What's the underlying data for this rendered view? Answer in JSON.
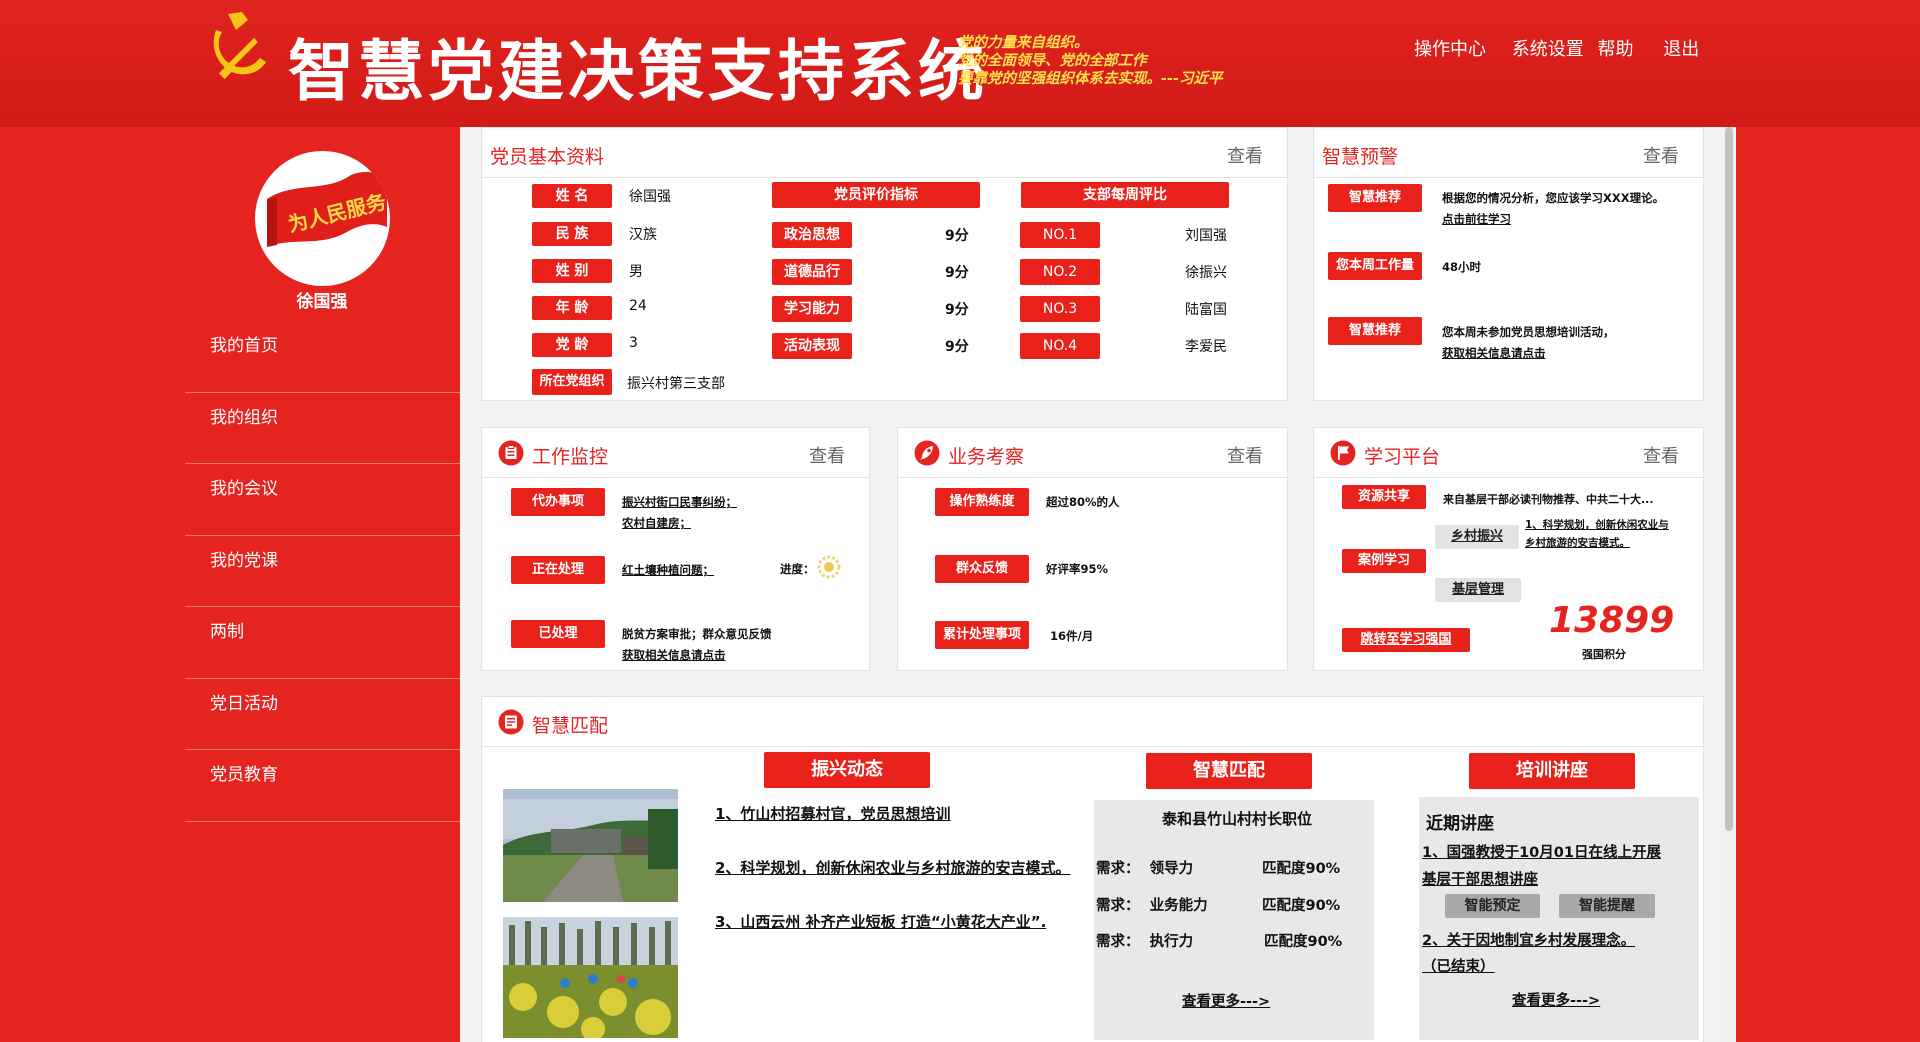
{
  "header": {
    "title": "智慧党建决策支持系统",
    "quote_lines": [
      "党的力量来自组织。",
      "党的全面领导、党的全部工作",
      "要靠党的坚强组织体系去实现。---习近平"
    ],
    "nav": [
      "操作中心",
      "系统设置",
      "帮助",
      "退出"
    ]
  },
  "sidebar": {
    "avatar_text": "为人民服务",
    "username": "徐国强",
    "menu": [
      "我的首页",
      "我的组织",
      "我的会议",
      "我的党课",
      "两制",
      "党日活动",
      "党员教育"
    ]
  },
  "profile": {
    "title": "党员基本资料",
    "more": "查看",
    "fields": [
      {
        "label": "姓 名",
        "value": "徐国强"
      },
      {
        "label": "民 族",
        "value": "汉族"
      },
      {
        "label": "姓 别",
        "value": "男"
      },
      {
        "label": "年 龄",
        "value": "24"
      },
      {
        "label": "党 龄",
        "value": "3"
      },
      {
        "label": "所在党组织",
        "value": "振兴村第三支部"
      }
    ],
    "eval_header": "党员评价指标",
    "evals": [
      {
        "label": "政治思想",
        "score": "9分"
      },
      {
        "label": "道德品行",
        "score": "9分"
      },
      {
        "label": "学习能力",
        "score": "9分"
      },
      {
        "label": "活动表现",
        "score": "9分"
      }
    ],
    "rank_header": "支部每周评比",
    "ranks": [
      {
        "label": "NO.1",
        "name": "刘国强"
      },
      {
        "label": "NO.2",
        "name": "徐振兴"
      },
      {
        "label": "NO.3",
        "name": "陆富国"
      },
      {
        "label": "NO.4",
        "name": "李爱民"
      }
    ]
  },
  "warning": {
    "title": "智慧预警",
    "more": "查看",
    "rows": [
      {
        "tag": "智慧推荐",
        "line1": "根据您的情况分析，您应该学习XXX理论。",
        "line2": "点击前往学习"
      },
      {
        "tag": "您本周工作量",
        "line1": "48小时",
        "line2": ""
      },
      {
        "tag": "智慧推荐",
        "line1": "您本周未参加党员思想培训活动，",
        "line2": "获取相关信息请点击"
      }
    ]
  },
  "monitor": {
    "title": "工作监控",
    "more": "查看",
    "rows": [
      {
        "tag": "代办事项",
        "line1": "振兴村街口民事纠纷；",
        "line2": "农村自建房；"
      },
      {
        "tag": "正在处理",
        "line1": "红土壤种植问题；",
        "line2": ""
      },
      {
        "tag": "已处理",
        "line1": "脱贫方案审批；群众意见反馈",
        "line2": "获取相关信息请点击"
      }
    ],
    "progress_label": "进度："
  },
  "business": {
    "title": "业务考察",
    "more": "查看",
    "rows": [
      {
        "tag": "操作熟练度",
        "value": "超过80%的人"
      },
      {
        "tag": "群众反馈",
        "value": "好评率95%"
      },
      {
        "tag": "累计处理事项",
        "value": "16件/月"
      }
    ]
  },
  "study": {
    "title": "学习平台",
    "more": "查看",
    "tag1": "资源共享",
    "tag1_text": "来自基层干部必读刊物推荐、中共二十大...",
    "gray1": "乡村振兴",
    "gray1_text1": "1、科学规划，创新休闲农业与",
    "gray1_text2": "乡村旅游的安吉模式。",
    "tag2": "案例学习",
    "gray2": "基层管理",
    "tag3": "跳转至学习强国",
    "score": "13899",
    "score_label": "强国积分"
  },
  "match": {
    "title": "智慧匹配",
    "col1": {
      "header": "振兴动态",
      "items": [
        "1、竹山村招募村官，党员思想培训",
        "2、科学规划，创新休闲农业与乡村旅游的安吉模式。",
        "3、山西云州 补齐产业短板 打造“小黄花大产业”."
      ]
    },
    "col2": {
      "header": "智慧匹配",
      "job": "泰和县竹山村村长职位",
      "reqs": [
        {
          "need": "需求：  领导力",
          "degree": "匹配度90%"
        },
        {
          "need": "需求：  业务能力",
          "degree": "匹配度90%"
        },
        {
          "need": "需求：  执行力",
          "degree": "匹配度90%"
        }
      ],
      "more": "查看更多--->"
    },
    "col3": {
      "header": "培训讲座",
      "subtitle": "近期讲座",
      "item1a": "1、国强教授于10月01日在线上开展",
      "item1b": "基层干部思想讲座",
      "btn1": "智能预定",
      "btn2": "智能提醒",
      "item2a": "2、关于因地制宜乡村发展理念。",
      "item2b": "（已结束）",
      "more": "查看更多--->"
    }
  },
  "colors": {
    "primary_red": "#e52420",
    "tag_red": "#e8211b",
    "quote_yellow": "#ffe14a"
  }
}
